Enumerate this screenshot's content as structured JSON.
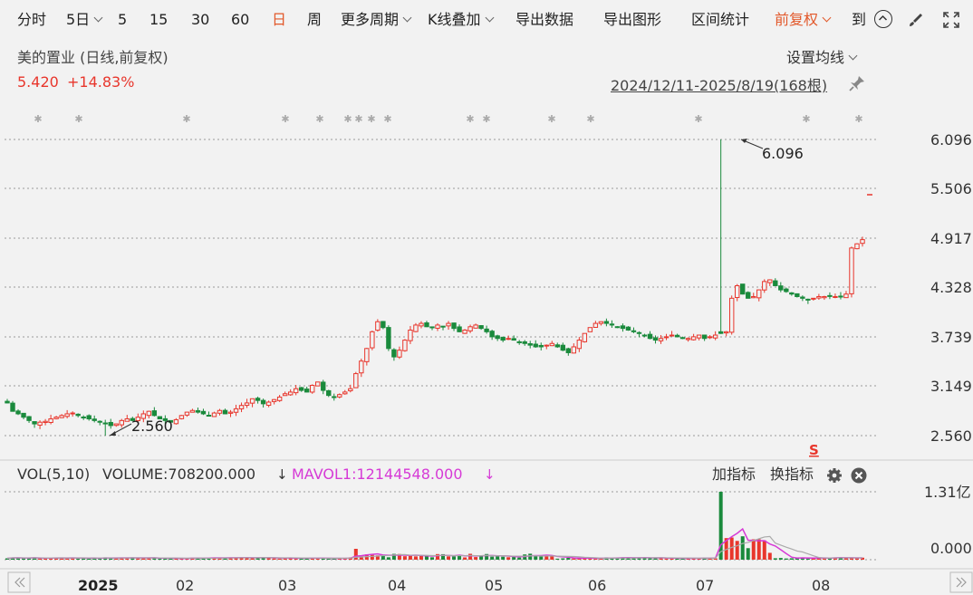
{
  "toolbar": {
    "items": [
      {
        "label": "分时"
      },
      {
        "label": "5日",
        "dropdown": true
      },
      {
        "label": "5"
      },
      {
        "label": "15"
      },
      {
        "label": "30"
      },
      {
        "label": "60"
      },
      {
        "label": "日",
        "active": true
      },
      {
        "label": "周"
      },
      {
        "label": "更多周期",
        "dropdown": true
      },
      {
        "label": "K线叠加",
        "dropdown": true
      },
      {
        "label": "导出数据"
      },
      {
        "label": "导出图形"
      },
      {
        "label": "区间统计"
      },
      {
        "label": "前复权",
        "dropdown": true,
        "active": true
      },
      {
        "label": "到"
      }
    ],
    "icons": [
      "arrow-up-circle-icon",
      "brush-icon",
      "fullscreen-icon"
    ]
  },
  "header": {
    "title": "美的置业 (日线,前复权)",
    "price": "5.420",
    "change": "+14.83%",
    "ma_setting": "设置均线",
    "range": "2024/12/11-2025/8/19(168根)"
  },
  "colors": {
    "up": "#e8362c",
    "down": "#1a8a3c",
    "accent": "#e2582a",
    "mavol": "#d63ad6",
    "grid": "#9a9a9a"
  },
  "chart_data": [
    {
      "type": "candlestick",
      "title": "美的置业 (日线,前复权)",
      "y_ticks": [
        "6.096",
        "5.506",
        "4.917",
        "4.328",
        "3.739",
        "3.149",
        "2.560"
      ],
      "ylim": [
        2.56,
        6.096
      ],
      "x_ticks": [
        "2025",
        "02",
        "03",
        "04",
        "05",
        "06",
        "07",
        "08"
      ],
      "annotations": [
        {
          "label": "6.096",
          "type": "max"
        },
        {
          "label": "2.560",
          "type": "min"
        }
      ],
      "series": [
        {
          "values": [
            2.95,
            2.85,
            2.82,
            2.78,
            2.74,
            2.7,
            2.72,
            2.73,
            2.76,
            2.78,
            2.8,
            2.82,
            2.83,
            2.8,
            2.78,
            2.76,
            2.74,
            2.72,
            2.7,
            2.68,
            2.7,
            2.74,
            2.76,
            2.74,
            2.78,
            2.82,
            2.85,
            2.8,
            2.76,
            2.74,
            2.72,
            2.75,
            2.8,
            2.84,
            2.86,
            2.84,
            2.82,
            2.8,
            2.83,
            2.86,
            2.82,
            2.84,
            2.88,
            2.92,
            2.95,
            3.0,
            2.98,
            2.94,
            2.96,
            2.99,
            3.02,
            3.06,
            3.08,
            3.12,
            3.1,
            3.08,
            3.16,
            3.2,
            3.1,
            3.04,
            3.02,
            3.05,
            3.08,
            3.12,
            3.3,
            3.45,
            3.6,
            3.8,
            3.92,
            3.85,
            3.6,
            3.5,
            3.58,
            3.7,
            3.82,
            3.88,
            3.9,
            3.86,
            3.85,
            3.88,
            3.86,
            3.9,
            3.84,
            3.8,
            3.82,
            3.86,
            3.88,
            3.84,
            3.8,
            3.74,
            3.72,
            3.7,
            3.72,
            3.7,
            3.68,
            3.66,
            3.64,
            3.62,
            3.62,
            3.64,
            3.66,
            3.62,
            3.58,
            3.55,
            3.62,
            3.7,
            3.78,
            3.85,
            3.9,
            3.92,
            3.9,
            3.88,
            3.86,
            3.84,
            3.82,
            3.8,
            3.78,
            3.75,
            3.72,
            3.7,
            3.72,
            3.74,
            3.76,
            3.74,
            3.72,
            3.72,
            3.74,
            3.76,
            3.72,
            3.74,
            3.76,
            3.78,
            3.8,
            4.2,
            4.35,
            4.25,
            4.2,
            4.22,
            4.3,
            4.4,
            4.42,
            4.35,
            4.3,
            4.28,
            4.25,
            4.22,
            4.2,
            4.18,
            4.2,
            4.22,
            4.22,
            4.23,
            4.22,
            4.22,
            4.25,
            4.8,
            4.85,
            4.9
          ]
        }
      ]
    },
    {
      "type": "bar",
      "title": "VOL(5,10)",
      "y_ticks": [
        "1.31亿",
        "0.000"
      ],
      "ylim": [
        0,
        131000000
      ],
      "legend": {
        "vol": "VOL(5,10)",
        "volume": "VOLUME:708200.000",
        "mavol": "MAVOL1:12144548.000"
      },
      "controls": {
        "add": "加指标",
        "swap": "换指标"
      }
    }
  ]
}
